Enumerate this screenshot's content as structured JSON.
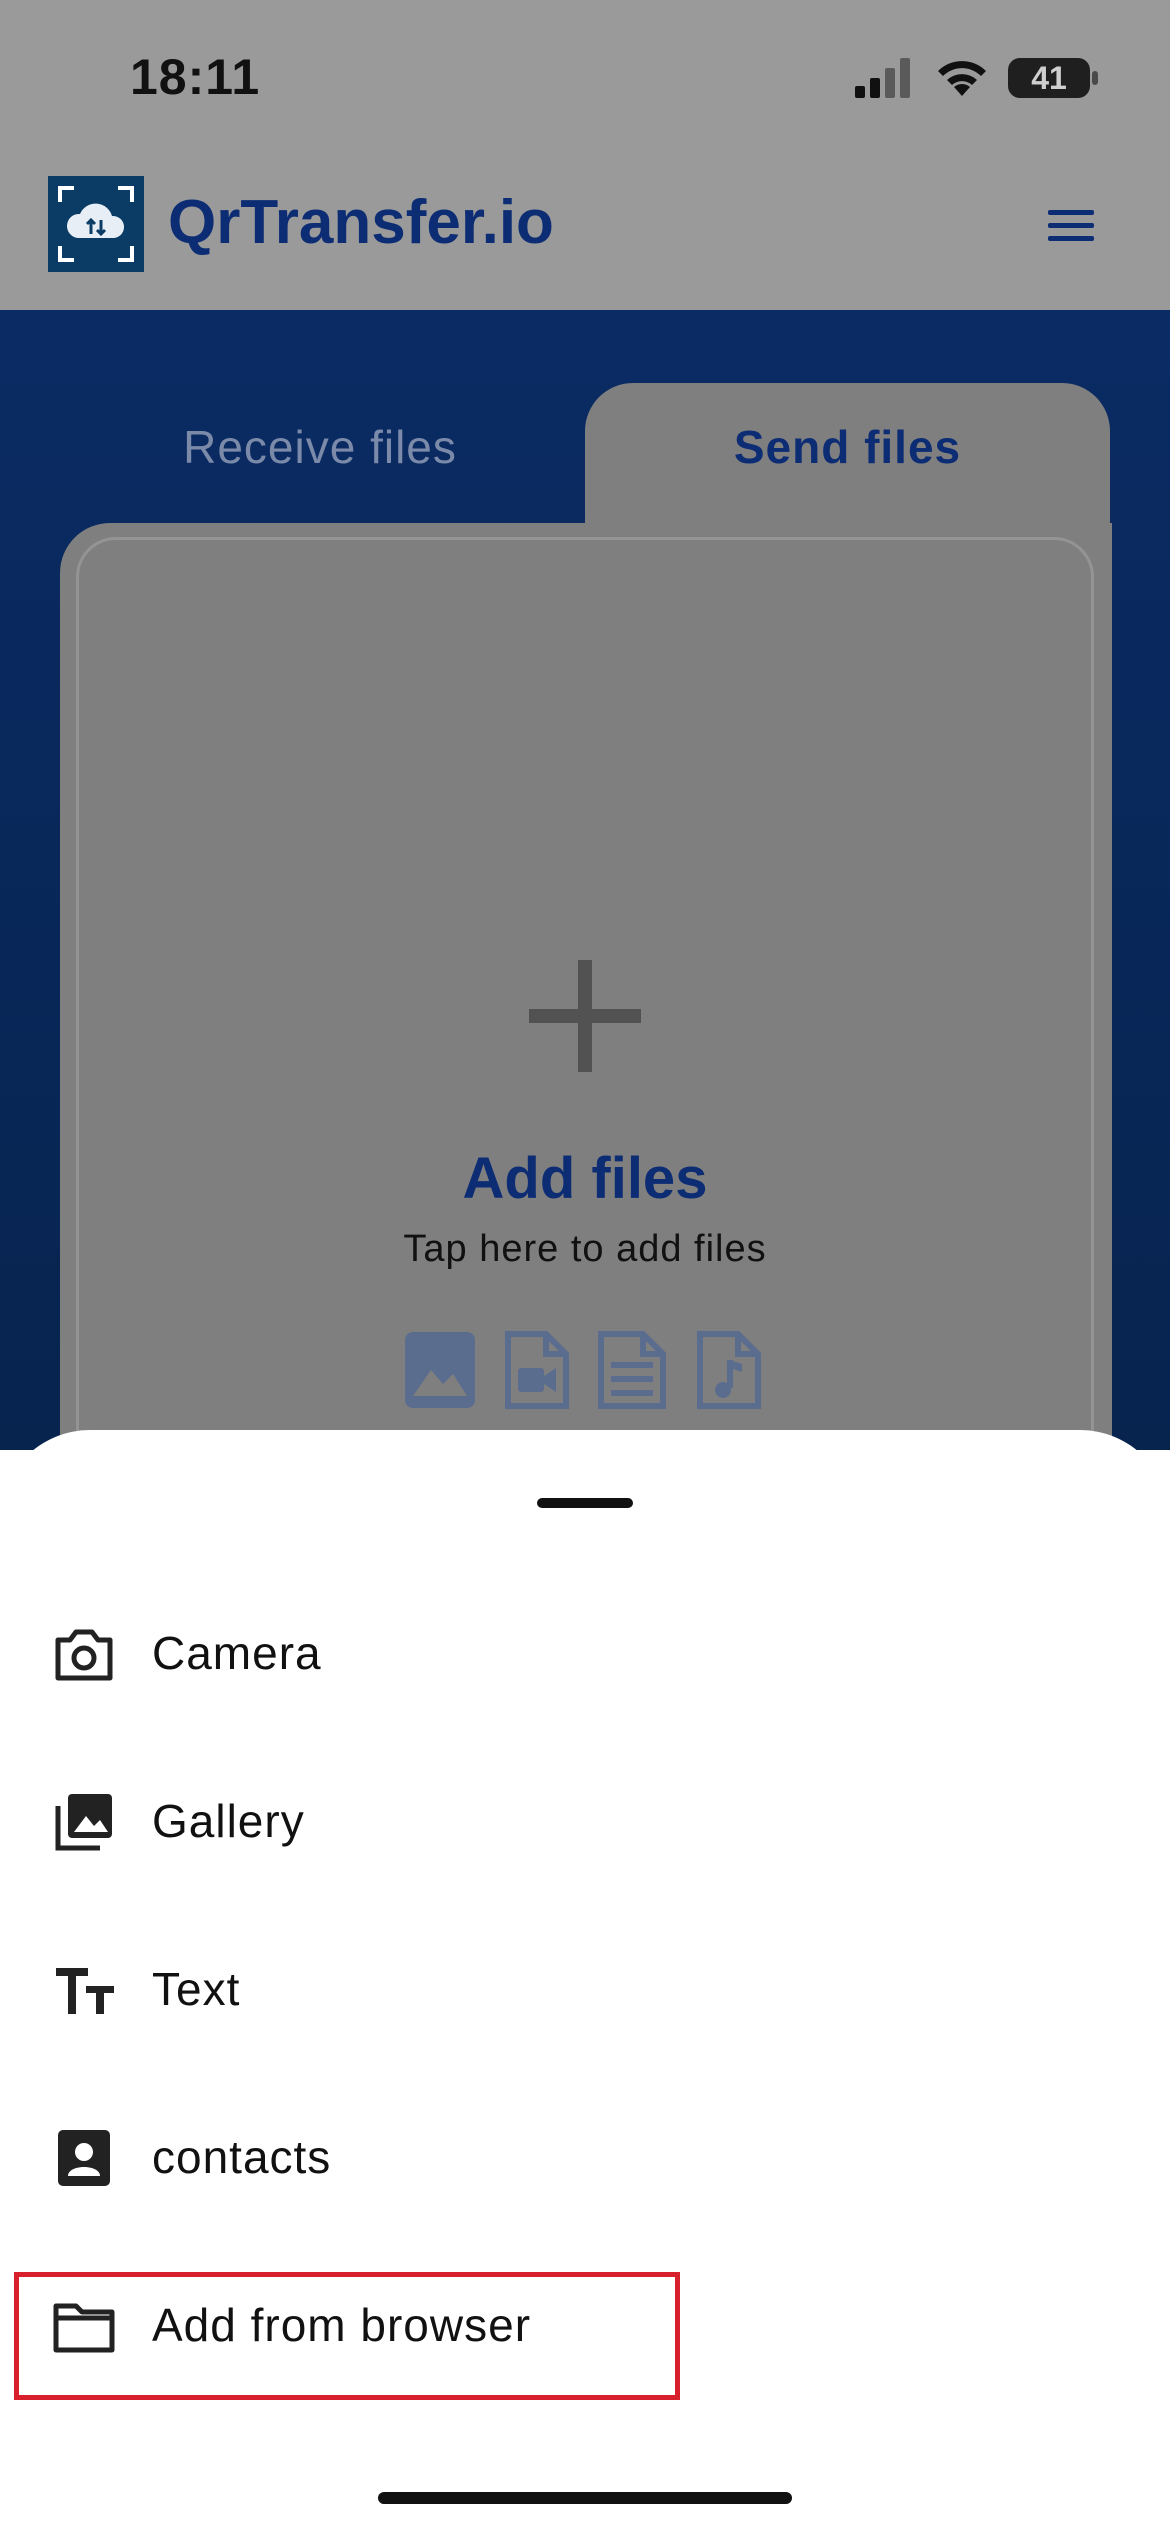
{
  "status_bar": {
    "time": "18:11",
    "battery": "41"
  },
  "header": {
    "app_title": "QrTransfer.io",
    "logo_icon": "cloud-transfer-icon",
    "menu_icon": "hamburger-menu-icon"
  },
  "tabs": [
    {
      "label": "Receive files",
      "active": false
    },
    {
      "label": "Send files",
      "active": true
    }
  ],
  "drop_zone": {
    "icon": "plus-icon",
    "title": "Add files",
    "subtitle": "Tap here to add files",
    "file_type_icons": [
      "image-file-icon",
      "video-file-icon",
      "document-file-icon",
      "audio-file-icon"
    ]
  },
  "sheet": {
    "items": [
      {
        "label": "Camera",
        "icon": "camera-icon"
      },
      {
        "label": "Gallery",
        "icon": "gallery-icon"
      },
      {
        "label": "Text",
        "icon": "text-size-icon"
      },
      {
        "label": "contacts",
        "icon": "contact-card-icon"
      },
      {
        "label": "Add from browser",
        "icon": "folder-icon",
        "highlighted": true
      }
    ]
  },
  "colors": {
    "brand": "#0c2c74",
    "highlight": "#d81f2c",
    "overlay": "#9a9a9a"
  }
}
